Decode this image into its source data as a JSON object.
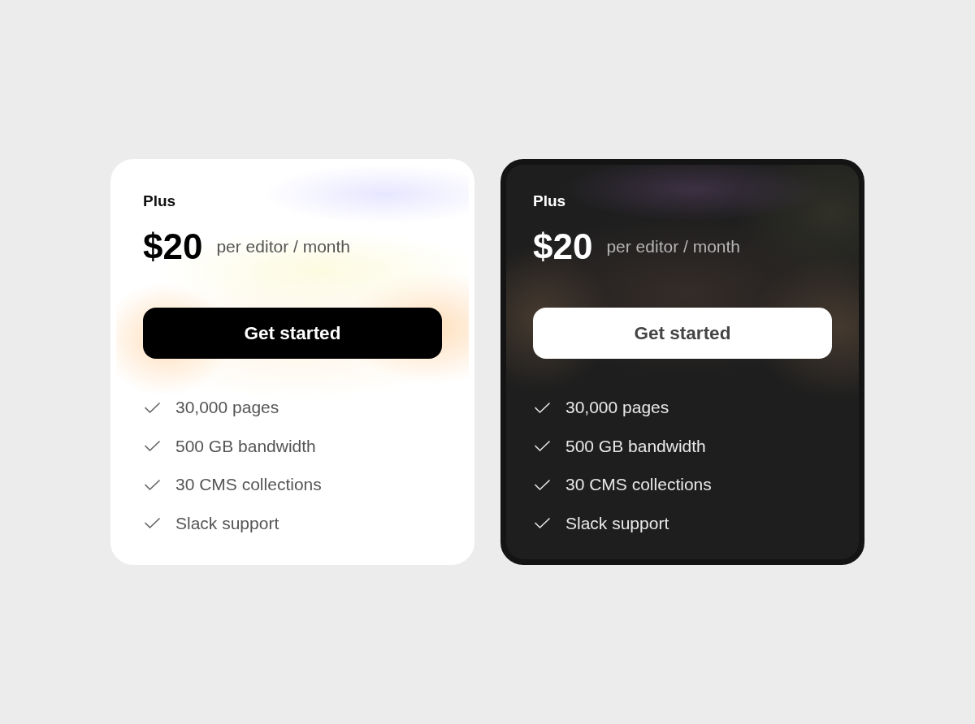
{
  "cards": [
    {
      "kind": "light",
      "plan": "Plus",
      "price": "$20",
      "period": "per editor / month",
      "button": "Get started",
      "features": [
        "30,000 pages",
        "500 GB bandwidth",
        "30 CMS collections",
        "Slack support"
      ]
    },
    {
      "kind": "dark",
      "plan": "Plus",
      "price": "$20",
      "period": "per editor / month",
      "button": "Get started",
      "features": [
        "30,000 pages",
        "500 GB bandwidth",
        "30 CMS collections",
        "Slack support"
      ]
    }
  ]
}
